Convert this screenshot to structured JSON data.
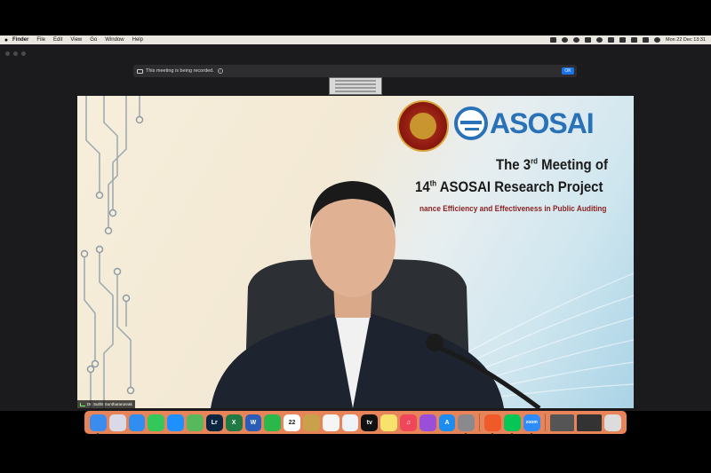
{
  "menubar": {
    "apple": "",
    "items": [
      "Finder",
      "File",
      "Edit",
      "View",
      "Go",
      "Window",
      "Help"
    ],
    "datetime": "Mon 22 Dec 13:31"
  },
  "meeting": {
    "recording_notice": "This meeting is being recorded.",
    "ok_label": "OK",
    "participant_name": "Dr. Suthit Sunthararunrak"
  },
  "slide": {
    "logo_text": "ASOSAI",
    "line1_pre": "The 3",
    "line1_sup": "rd",
    "line1_post": " Meeting of",
    "line2_pre": "14",
    "line2_sup": "th",
    "line2_post": " ASOSAI Research Project",
    "line3": "nance Efficiency and Effectiveness in Public Auditing"
  },
  "dock": {
    "apps": [
      {
        "name": "finder-icon",
        "label": "",
        "color": "#3c8cf0"
      },
      {
        "name": "launchpad-icon",
        "label": "",
        "color": "#d9d9e8"
      },
      {
        "name": "mail-icon",
        "label": "",
        "color": "#2f8ef0"
      },
      {
        "name": "messages-icon",
        "label": "",
        "color": "#34c759"
      },
      {
        "name": "safari-icon",
        "label": "",
        "color": "#1e90ff"
      },
      {
        "name": "maps-icon",
        "label": "",
        "color": "#58b85c"
      },
      {
        "name": "lightroom-icon",
        "label": "Lr",
        "color": "#0a2540"
      },
      {
        "name": "excel-icon",
        "label": "X",
        "color": "#1f7a44"
      },
      {
        "name": "word-icon",
        "label": "W",
        "color": "#2b5cb8"
      },
      {
        "name": "facetime-icon",
        "label": "",
        "color": "#2bb84b"
      },
      {
        "name": "calendar-icon",
        "label": "22",
        "color": "#ffffff"
      },
      {
        "name": "photos-icon",
        "label": "",
        "color": "#c9a14a"
      },
      {
        "name": "reminders-icon",
        "label": "",
        "color": "#f5f5f5"
      },
      {
        "name": "freeform-icon",
        "label": "",
        "color": "#eef3fa"
      },
      {
        "name": "appletv-icon",
        "label": "tv",
        "color": "#111111"
      },
      {
        "name": "notes-icon",
        "label": "",
        "color": "#f7e26b"
      },
      {
        "name": "music-icon",
        "label": "♫",
        "color": "#f0465a"
      },
      {
        "name": "podcasts-icon",
        "label": "",
        "color": "#9b4fd9"
      },
      {
        "name": "appstore-icon",
        "label": "A",
        "color": "#1e8cf0"
      },
      {
        "name": "settings-icon",
        "label": "",
        "color": "#8a8a8e"
      },
      {
        "name": "brave-icon",
        "label": "",
        "color": "#f05a28"
      },
      {
        "name": "line-icon",
        "label": "",
        "color": "#06c755"
      },
      {
        "name": "zoom-icon",
        "label": "zoom",
        "color": "#2d8cff"
      }
    ],
    "extras": [
      {
        "name": "window-thumb-icon",
        "color": "#555555"
      },
      {
        "name": "window-thumb-icon-2",
        "color": "#333333"
      },
      {
        "name": "trash-icon",
        "color": "#dcdcdc"
      }
    ]
  }
}
